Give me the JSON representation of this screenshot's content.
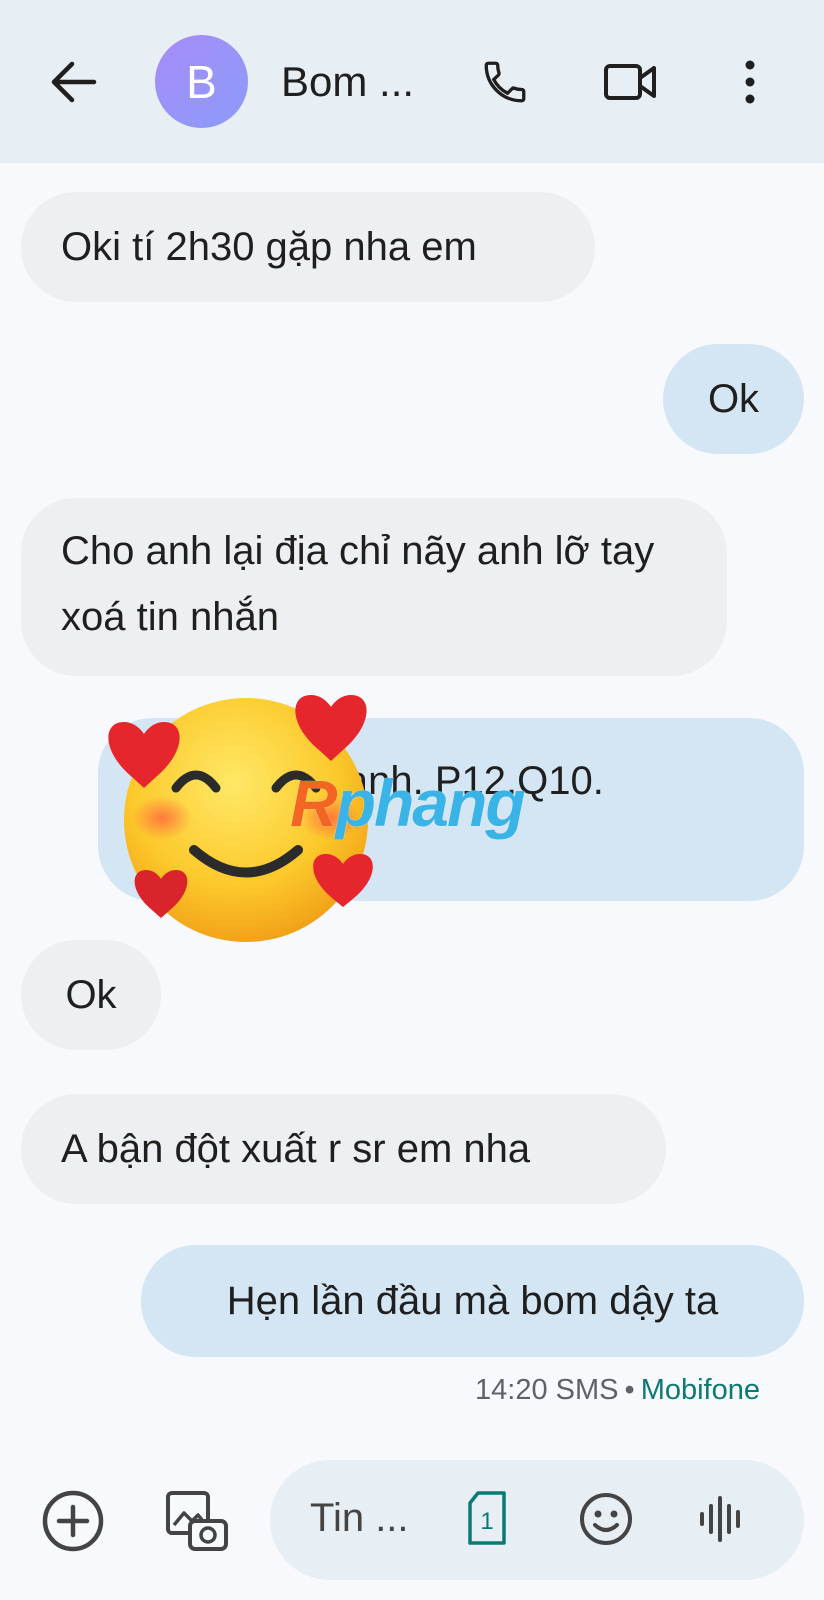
{
  "header": {
    "avatar_letter": "B",
    "contact_name": "Bom ..."
  },
  "messages": [
    {
      "direction": "in",
      "text": "Oki tí 2h30 gặp nha em"
    },
    {
      "direction": "out",
      "text": "Ok"
    },
    {
      "direction": "in",
      "text": "Cho anh lại địa chỉ nãy anh lỡ tay xoá tin nhắn"
    },
    {
      "direction": "out",
      "text_visible": "ạn hạnh. P12.Q10.",
      "text_visible_2": "g"
    },
    {
      "direction": "in",
      "text": "Ok"
    },
    {
      "direction": "in",
      "text": "A bận đột xuất r sr em nha"
    },
    {
      "direction": "out",
      "text": "Hẹn lần đầu mà bom dậy ta"
    }
  ],
  "meta": {
    "time": "14:20 SMS",
    "carrier": "Mobifone"
  },
  "watermark": "Rphang",
  "composer": {
    "placeholder": "Tin ...",
    "sim_label": "1"
  },
  "colors": {
    "header_bg": "#e7eef4",
    "incoming_bubble": "#eeeff2",
    "outgoing_bubble": "#d4e6f3",
    "carrier_text": "#0b7a75"
  }
}
